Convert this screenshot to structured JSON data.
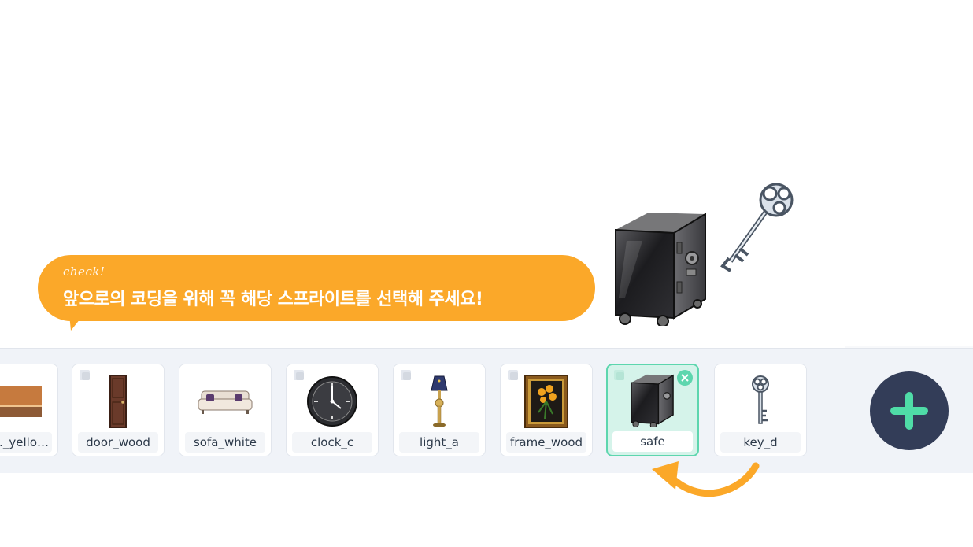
{
  "tooltip": {
    "check": "check!",
    "message": "앞으로의 코딩을 위해 꼭 해당 스프라이트를 선택해 주세요!"
  },
  "sprites": [
    {
      "name": "…_yello…",
      "thumb": "room-yellow-icon"
    },
    {
      "name": "door_wood",
      "thumb": "door-icon"
    },
    {
      "name": "sofa_white",
      "thumb": "sofa-icon"
    },
    {
      "name": "clock_c",
      "thumb": "clock-icon"
    },
    {
      "name": "light_a",
      "thumb": "lamp-icon"
    },
    {
      "name": "frame_wood",
      "thumb": "picture-frame-icon"
    },
    {
      "name": "safe",
      "thumb": "safe-icon",
      "selected": true
    },
    {
      "name": "key_d",
      "thumb": "key-icon"
    }
  ],
  "colors": {
    "accent": "#fba829",
    "selected": "#5dd6ae",
    "add_button": "#333d58",
    "tray": "#f0f3f8"
  }
}
